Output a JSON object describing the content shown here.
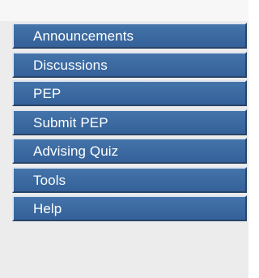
{
  "sidebar": {
    "items": [
      {
        "label": "Announcements"
      },
      {
        "label": "Discussions"
      },
      {
        "label": "PEP"
      },
      {
        "label": "Submit PEP"
      },
      {
        "label": "Advising Quiz"
      },
      {
        "label": "Tools"
      },
      {
        "label": "Help"
      }
    ]
  },
  "colors": {
    "button_fill": "#3b69a0",
    "button_highlight": "#dfe5ee",
    "button_shadow": "#2a4467",
    "panel_background": "#ececec"
  }
}
